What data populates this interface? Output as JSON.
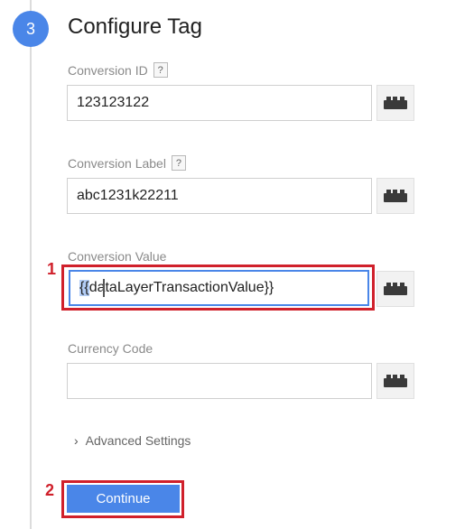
{
  "step": {
    "number": "3",
    "title": "Configure Tag"
  },
  "fields": [
    {
      "label": "Conversion ID",
      "help": "?",
      "value": "123123122"
    },
    {
      "label": "Conversion Label",
      "help": "?",
      "value": "abc1231k22211"
    },
    {
      "label": "Conversion Value",
      "value_selected": "{{",
      "value_rest": "dataLayerTransactionValue}}"
    },
    {
      "label": "Currency Code",
      "value": ""
    }
  ],
  "advanced": {
    "chevron": "›",
    "label": "Advanced Settings"
  },
  "continue_label": "Continue",
  "annotations": {
    "one": "1",
    "two": "2"
  },
  "icons": {
    "variable_button": "lego-brick-icon",
    "help": "question-icon"
  },
  "colors": {
    "accent": "#4a86e8",
    "annotation": "#d0202b"
  }
}
